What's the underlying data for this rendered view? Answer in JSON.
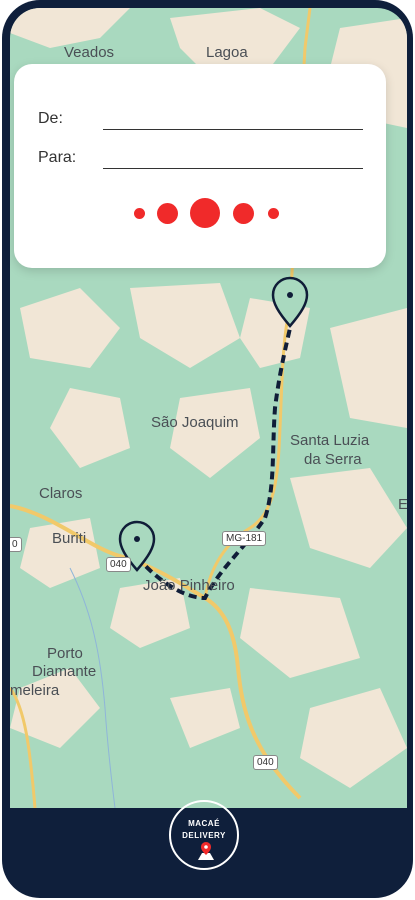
{
  "form": {
    "from_label": "De:",
    "to_label": "Para:"
  },
  "map": {
    "places": [
      "Veados",
      "Lagoa",
      "São Joaquim",
      "Santa Luzia",
      "da Serra",
      "Claros",
      "Buriti",
      "João Pinheiro",
      "Porto",
      "Diamante",
      "meleira",
      "E"
    ],
    "road_shields": [
      "MG-181",
      "040",
      "040",
      "0"
    ]
  },
  "logo": {
    "line1": "MACAÉ",
    "line2": "DELIVERY"
  },
  "colors": {
    "frame": "#0f1f3b",
    "map_green": "#a9d9bf",
    "map_beige": "#f3e6d8",
    "road": "#f1c96a",
    "route": "#101d38",
    "accent": "#f02a2a"
  }
}
